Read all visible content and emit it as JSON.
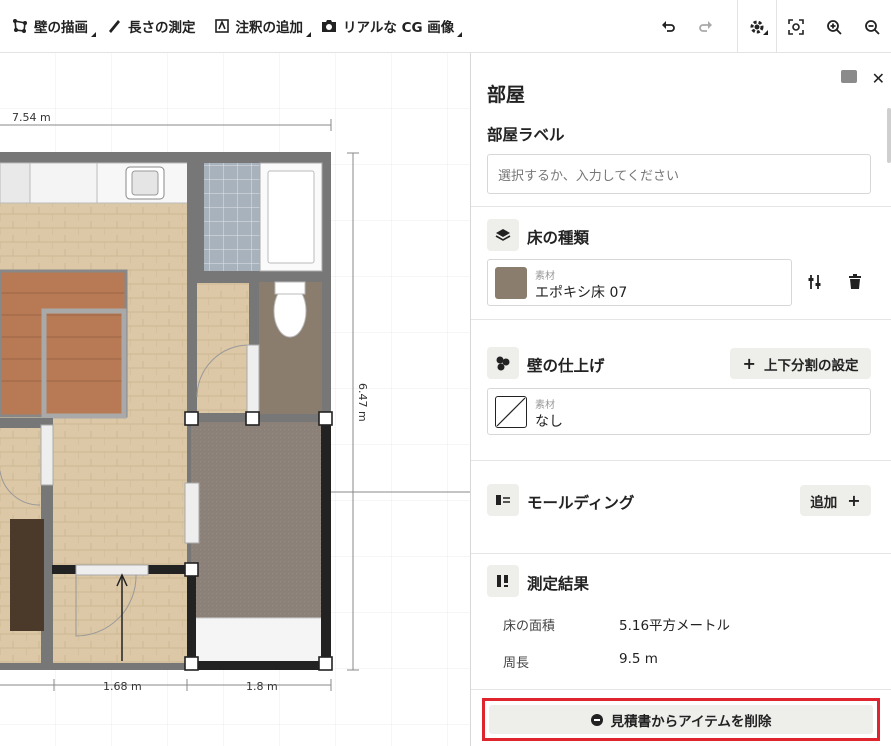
{
  "toolbar": {
    "draw_wall": "壁の描画",
    "measure_length": "長さの測定",
    "add_annotation": "注釈の追加",
    "realistic_cg": "リアルな CG 画像"
  },
  "canvas": {
    "dim_top": "7.54 m",
    "dim_right": "6.47 m",
    "dim_bottom_left": "1.68 m",
    "dim_bottom_right": "1.8 m"
  },
  "panel": {
    "title": "部屋",
    "room_label_heading": "部屋ラベル",
    "room_label_placeholder": "選択するか、入力してください",
    "floor": {
      "heading": "床の種類",
      "material_key": "素材",
      "material_value": "エポキシ床 07",
      "swatch_color": "#8a7d6e"
    },
    "wall": {
      "heading": "壁の仕上げ",
      "split_button": "上下分割の設定",
      "material_key": "素材",
      "material_value": "なし"
    },
    "molding": {
      "heading": "モールディング",
      "add_button": "追加"
    },
    "measure": {
      "heading": "測定結果",
      "area_label": "床の面積",
      "area_value": "5.16平方メートル",
      "perimeter_label": "周長",
      "perimeter_value": "9.5 m"
    },
    "remove_button": "見積書からアイテムを削除"
  },
  "colors": {
    "accent_red": "#e0242e",
    "chip_bg": "#eeeeea",
    "wall": "#6e6e6e",
    "wood": "#dcc8a6",
    "stairs": "#b87a55",
    "carpet": "#8c8178"
  }
}
